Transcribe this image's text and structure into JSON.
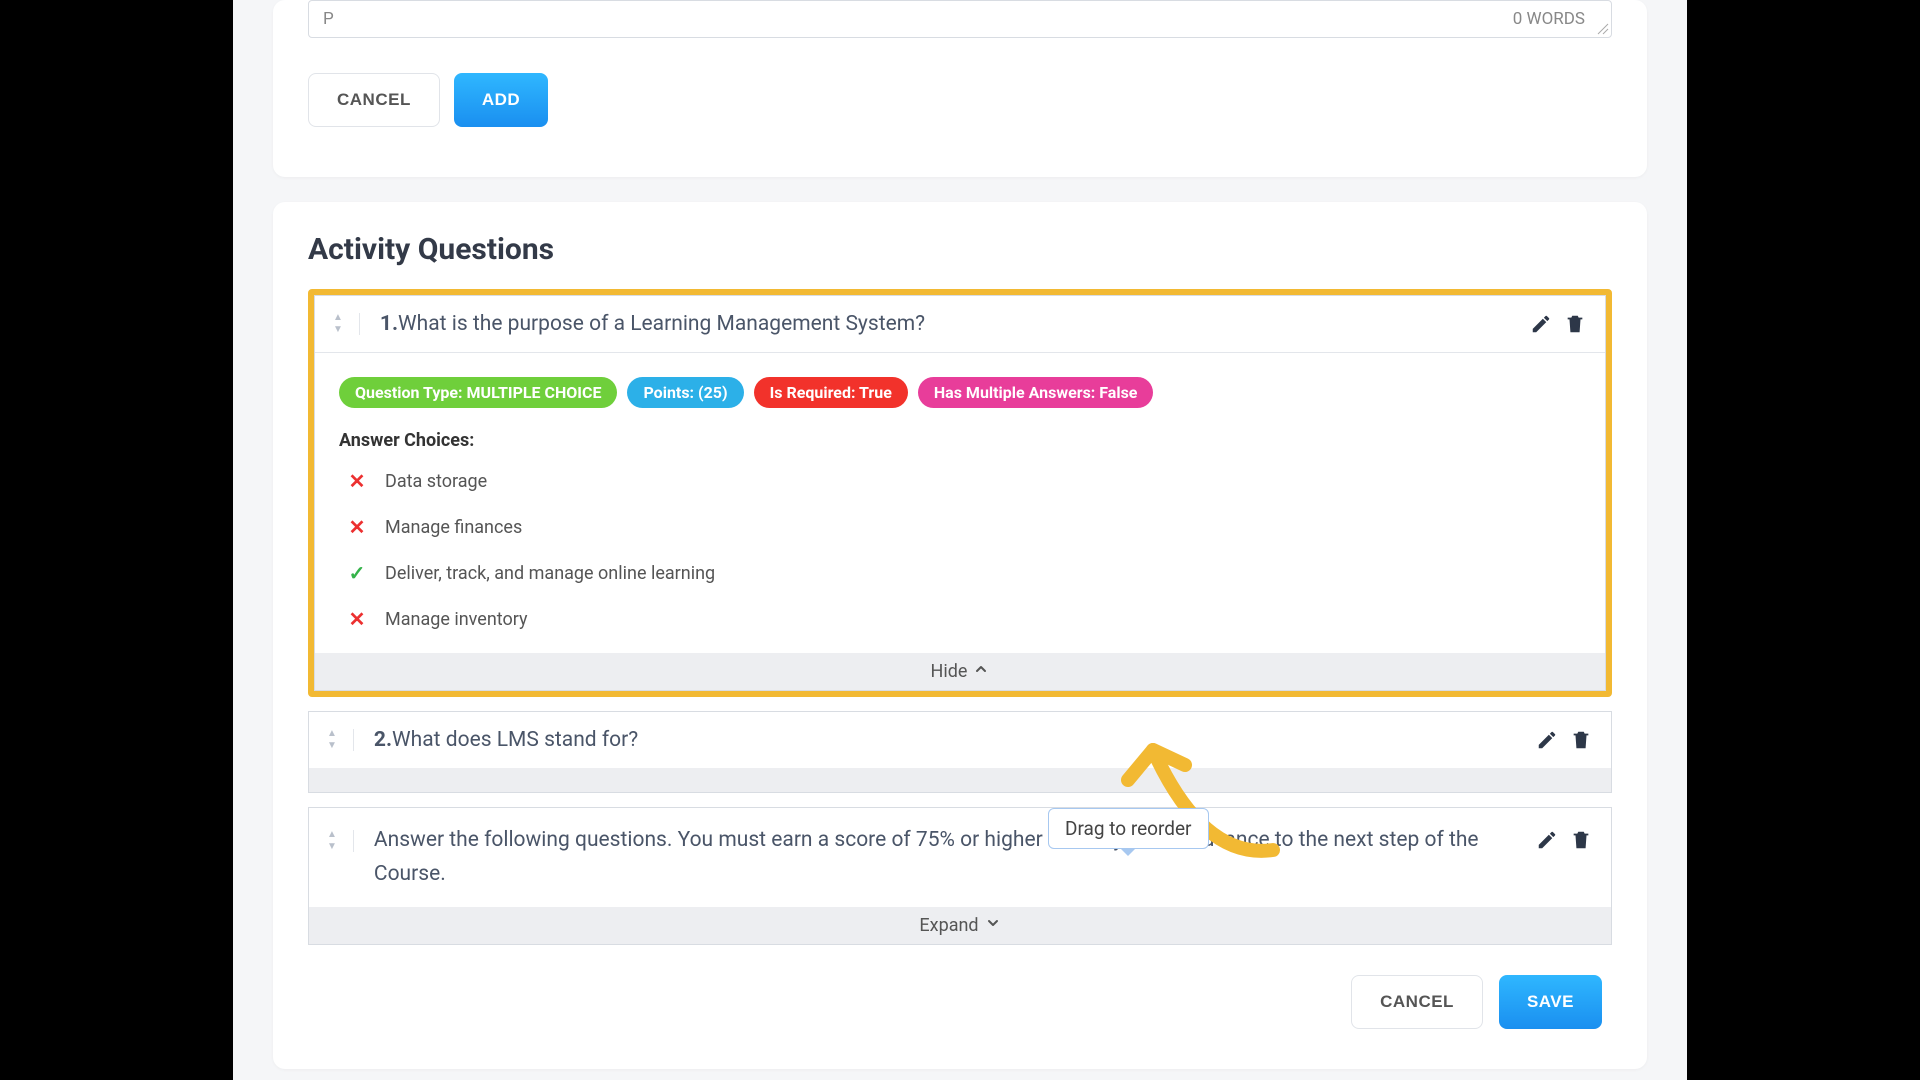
{
  "editor": {
    "placeholder_like": "P",
    "word_count": "0 WORDS"
  },
  "top_buttons": {
    "cancel": "CANCEL",
    "add": "ADD"
  },
  "section_title": "Activity Questions",
  "question1": {
    "number": "1.",
    "text": "What is the purpose of a Learning Management System?",
    "badge_type": "Question Type: MULTIPLE CHOICE",
    "badge_points": "Points: (25)",
    "badge_required": "Is Required: True",
    "badge_multi": "Has Multiple Answers: False",
    "answers_heading": "Answer Choices:",
    "choices": [
      {
        "correct": false,
        "text": "Data storage"
      },
      {
        "correct": false,
        "text": "Manage finances"
      },
      {
        "correct": true,
        "text": "Deliver, track, and manage online learning"
      },
      {
        "correct": false,
        "text": "Manage inventory"
      }
    ],
    "toggle": "Hide"
  },
  "question2": {
    "number": "2.",
    "text": "What does LMS stand for?"
  },
  "tooltip": "Drag to reorder",
  "instruction_block": {
    "text": "Answer the following questions. You must earn a score of 75% or higher before you can advance to the next step of the Course.",
    "toggle": "Expand"
  },
  "footer": {
    "cancel": "CANCEL",
    "save": "SAVE"
  }
}
